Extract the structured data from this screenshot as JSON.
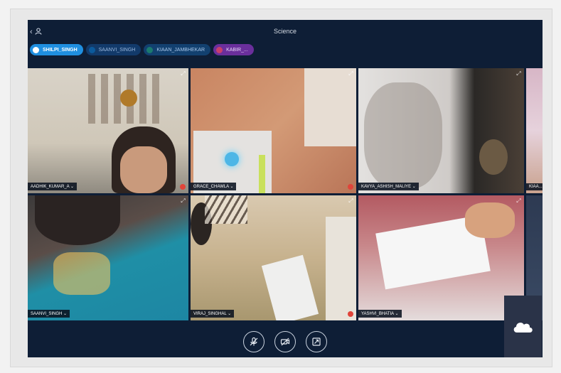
{
  "window": {
    "title": "Science",
    "back_glyph": "‹"
  },
  "participants_bar": [
    {
      "name": "SHILPI_SINGH",
      "active": true
    },
    {
      "name": "SAANVI_SINGH",
      "active": false
    },
    {
      "name": "KIAAN_JAMBHEKAR",
      "active": false
    },
    {
      "name": "KABIR_...",
      "active": false
    }
  ],
  "tiles": [
    {
      "label": "AADHIK_KUMAR_A ⌄",
      "muted": true
    },
    {
      "label": "GRACE_CHAWLA ⌄",
      "muted": true
    },
    {
      "label": "KAVYA_ASHISH_MALIYE ⌄",
      "muted": false
    },
    {
      "label": "KIAA...",
      "muted": false
    },
    {
      "label": "SAANVI_SINGH ⌄",
      "muted": false
    },
    {
      "label": "VIRAJ_SINGHAL ⌄",
      "muted": true
    },
    {
      "label": "YASHVI_BHATIA ⌄",
      "muted": false
    }
  ],
  "controls": {
    "mic_icon": "microphone-off-icon",
    "camera_icon": "camera-off-icon",
    "share_icon": "screen-share-stop-icon"
  },
  "side_button": {
    "icon": "cloud-icon"
  }
}
